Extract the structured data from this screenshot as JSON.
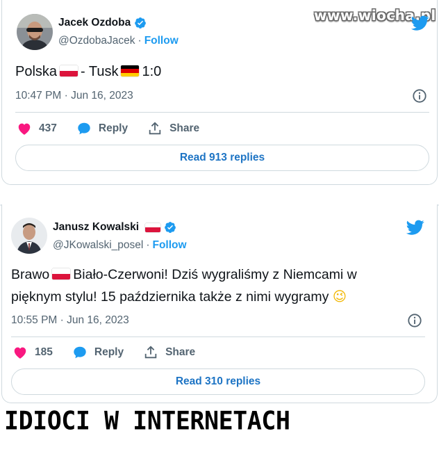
{
  "watermark": "www.wiocha.pl",
  "caption": "IDIOCI W INTERNETACH",
  "tweets": [
    {
      "author_name": "Jacek Ozdoba",
      "handle": "@OzdobaJacek",
      "follow_label": "Follow",
      "text_parts": [
        "Polska",
        "- Tusk",
        "1:0"
      ],
      "timestamp": "10:47 PM · Jun 16, 2023",
      "likes": "437",
      "reply_label": "Reply",
      "share_label": "Share",
      "replies_button": "Read 913 replies"
    },
    {
      "author_name": "Janusz Kowalski",
      "handle": "@JKowalski_posel",
      "follow_label": "Follow",
      "text_parts": [
        "Brawo",
        "Biało-Czerwoni! Dziś wygraliśmy z Niemcami w",
        "pięknym stylu! 15 października także z nimi wygramy",
        "😉"
      ],
      "timestamp": "10:55 PM · Jun 16, 2023",
      "likes": "185",
      "reply_label": "Reply",
      "share_label": "Share",
      "replies_button": "Read 310 replies"
    }
  ],
  "colors": {
    "accent": "#1d9bf0",
    "like": "#f91880",
    "muted": "#536471",
    "border": "#cfd9de"
  },
  "icons": [
    "verified-badge-icon",
    "twitter-bird-icon",
    "heart-icon",
    "reply-bubble-icon",
    "share-icon",
    "info-icon",
    "poland-flag-icon",
    "germany-flag-icon",
    "winking-face-emoji"
  ]
}
